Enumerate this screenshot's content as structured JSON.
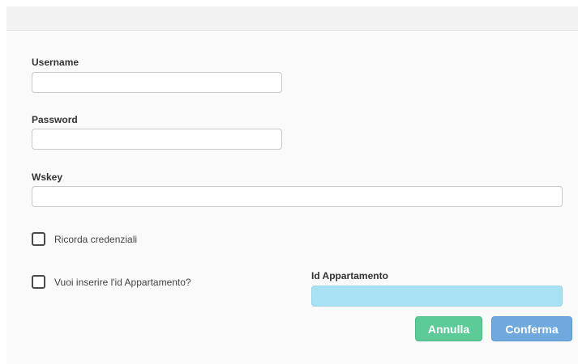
{
  "form": {
    "username": {
      "label": "Username",
      "value": ""
    },
    "password": {
      "label": "Password",
      "value": ""
    },
    "wskey": {
      "label": "Wskey",
      "value": ""
    },
    "remember_credentials": {
      "label": "Ricorda credenziali",
      "checked": false
    },
    "insert_apartment_id": {
      "label": "Vuoi inserire l'id Appartamento?",
      "checked": false
    },
    "apartment_id": {
      "label": "Id Appartamento",
      "value": ""
    }
  },
  "actions": {
    "cancel_label": "Annulla",
    "confirm_label": "Conferma"
  },
  "colors": {
    "cancel_button": "#5ccb98",
    "confirm_button": "#6fa9de",
    "apartment_input_bg": "#a9e1f4"
  }
}
